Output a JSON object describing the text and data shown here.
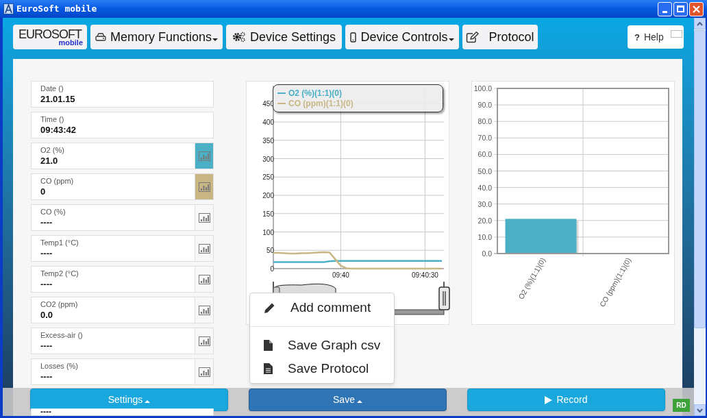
{
  "window": {
    "title": "EuroSoft mobile"
  },
  "nav": {
    "logo": {
      "brand": "EUROSOFT",
      "sub": "mobile"
    },
    "items": [
      {
        "label": "Memory Functions",
        "dropdown": true
      },
      {
        "label": "Device Settings",
        "dropdown": false
      },
      {
        "label": "Device Controls",
        "dropdown": true
      },
      {
        "label": "Protocol",
        "dropdown": false
      }
    ],
    "help": {
      "icon_text": "?",
      "label": "Help"
    }
  },
  "readings": [
    {
      "label": "Date ()",
      "value": "21.01.15",
      "graph": false
    },
    {
      "label": "Time ()",
      "value": "09:43:42",
      "graph": false
    },
    {
      "label": "O2 (%)",
      "value": "21.0",
      "graph": true,
      "color": "#4bafc6"
    },
    {
      "label": "CO (ppm)",
      "value": "0",
      "graph": true,
      "color": "#c8b785"
    },
    {
      "label": "CO (%)",
      "value": "----",
      "graph": true
    },
    {
      "label": "Temp1 (°C)",
      "value": "----",
      "graph": true
    },
    {
      "label": "Temp2 (°C)",
      "value": "----",
      "graph": true
    },
    {
      "label": "CO2 (ppm)",
      "value": "0.0",
      "graph": true
    },
    {
      "label": "Excess-air ()",
      "value": "----",
      "graph": true
    },
    {
      "label": "Losses (%)",
      "value": "----",
      "graph": true
    },
    {
      "value": "----"
    }
  ],
  "line_chart": {
    "chart_data": {
      "type": "line",
      "categories": [
        null,
        null,
        null,
        null,
        null,
        null,
        null,
        null,
        null,
        null,
        null,
        null,
        "09:40",
        null,
        null,
        null,
        null,
        null,
        null,
        null,
        null,
        null,
        null,
        null,
        null,
        null,
        null,
        "09:40:30",
        null,
        null,
        null
      ],
      "series": [
        {
          "name": "O2 (%)(1:1)(0)",
          "color": "#4bafc6",
          "values": [
            18,
            18,
            18,
            18,
            18,
            18,
            18,
            18,
            18,
            18,
            20,
            21,
            21,
            21,
            21,
            21,
            21,
            21,
            21,
            21,
            21,
            21,
            21,
            21,
            21,
            21,
            21,
            21,
            21,
            21,
            21
          ]
        },
        {
          "name": "CO (ppm)(1:1)(0)",
          "color": "#c8b785",
          "values": [
            43,
            43,
            42,
            41,
            41,
            42,
            42,
            43,
            44,
            45,
            44,
            26,
            8,
            1,
            0,
            0,
            0,
            0,
            0,
            0,
            0,
            0,
            0,
            0,
            0,
            0,
            0,
            0,
            0,
            0,
            0
          ]
        }
      ],
      "ylim": [
        0,
        500
      ],
      "grid": true,
      "legend": "top",
      "yticks": [
        0,
        50,
        100,
        150,
        200,
        250,
        300,
        350,
        400,
        450
      ]
    }
  },
  "bar_chart": {
    "chart_data": {
      "type": "bar",
      "grid": true,
      "categories": [
        "O2 (%)(1:1)(0)",
        "CO (ppm)(1:1)(0)"
      ],
      "values": [
        21.0,
        0
      ],
      "ylim": [
        0,
        100
      ],
      "yticks": [
        {
          "value": 0,
          "label": "0.0"
        },
        {
          "value": 10,
          "label": "10.0"
        },
        {
          "value": 20,
          "label": "20.0"
        },
        {
          "value": 30,
          "label": "30.0"
        },
        {
          "value": 40,
          "label": "40.0"
        },
        {
          "value": 50,
          "label": "50.0"
        },
        {
          "value": 60,
          "label": "60.0"
        },
        {
          "value": 70,
          "label": "70.0"
        },
        {
          "value": 80,
          "label": "80.0"
        },
        {
          "value": 90,
          "label": "90.0"
        },
        {
          "value": 100,
          "label": "100.0"
        }
      ]
    }
  },
  "save_menu": {
    "sections": [
      {
        "items": [
          {
            "label": "Add comment"
          }
        ]
      },
      {
        "items": [
          {
            "label": "Save Graph csv"
          },
          {
            "label": "Save Protocol"
          }
        ]
      }
    ]
  },
  "bottom_buttons": [
    {
      "label": "Settings",
      "caret": true,
      "selected": false
    },
    {
      "label": "Save",
      "caret": true,
      "selected": true
    },
    {
      "label": "Record",
      "caret": false,
      "selected": false
    }
  ],
  "status_badge": "RD"
}
